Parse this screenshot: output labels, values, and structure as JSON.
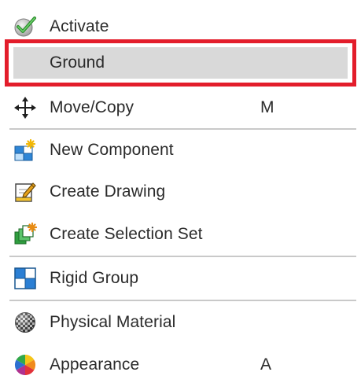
{
  "menu": {
    "items": [
      {
        "label": "Activate",
        "icon": "checkmark-circle-icon",
        "shortcut": ""
      },
      {
        "label": "Ground",
        "icon": "",
        "shortcut": "",
        "highlighted": true
      },
      {
        "label": "Move/Copy",
        "icon": "move-arrows-icon",
        "shortcut": "M"
      },
      {
        "label": "New Component",
        "icon": "new-component-icon",
        "shortcut": ""
      },
      {
        "label": "Create Drawing",
        "icon": "create-drawing-icon",
        "shortcut": ""
      },
      {
        "label": "Create Selection Set",
        "icon": "selection-set-icon",
        "shortcut": ""
      },
      {
        "label": "Rigid Group",
        "icon": "rigid-group-icon",
        "shortcut": ""
      },
      {
        "label": "Physical Material",
        "icon": "physical-material-icon",
        "shortcut": ""
      },
      {
        "label": "Appearance",
        "icon": "appearance-icon",
        "shortcut": "A"
      }
    ]
  },
  "colors": {
    "highlight_border": "#e31d2b",
    "highlight_fill": "#d9d9d9",
    "divider": "#c9c9c9"
  }
}
